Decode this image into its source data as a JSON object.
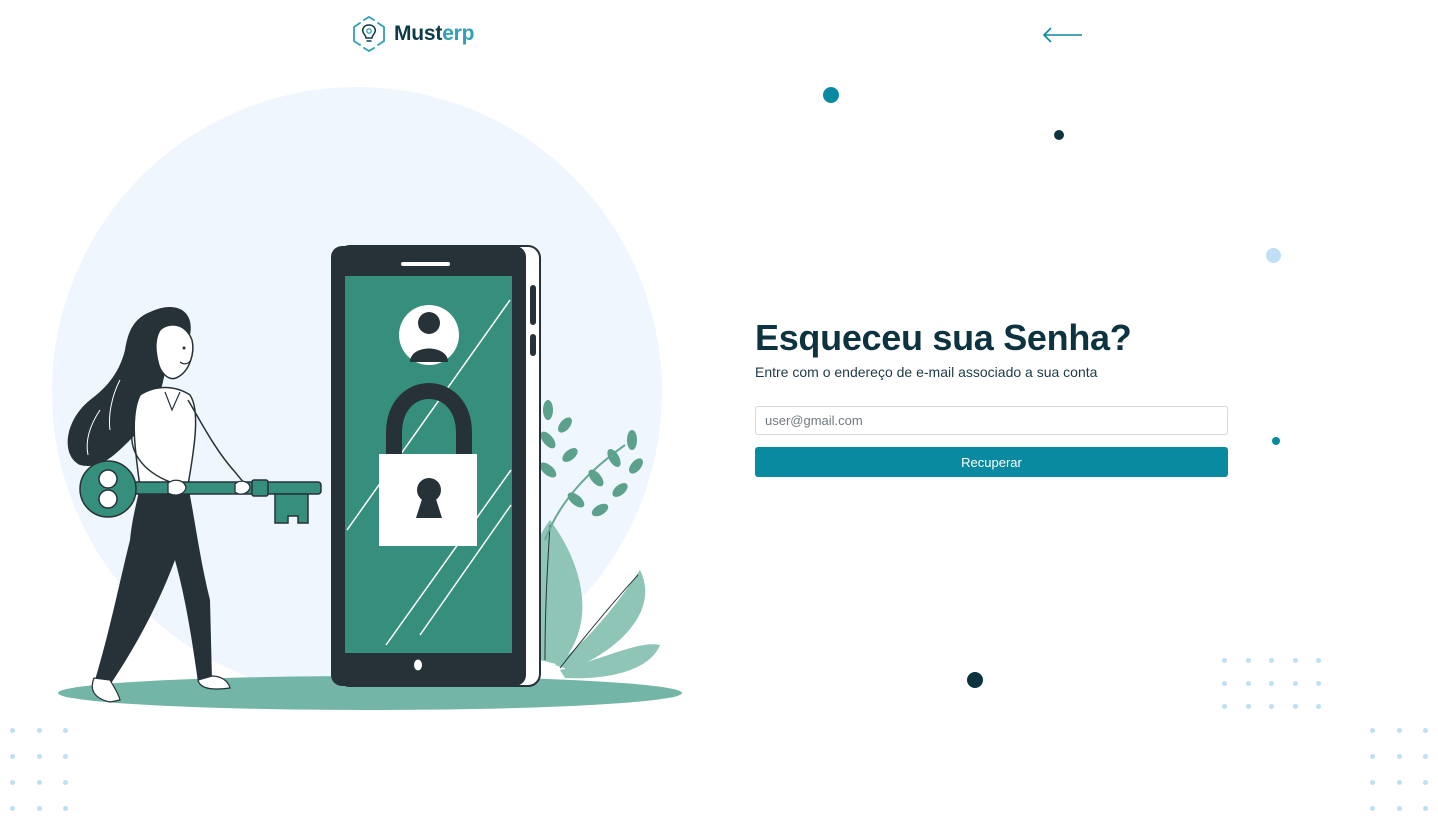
{
  "brand": {
    "name_part1": "Must",
    "name_part2": "erp"
  },
  "icons": {
    "logo": "lightbulb-gear-icon",
    "back": "arrow-left-icon"
  },
  "form": {
    "title": "Esqueceu sua Senha?",
    "subtitle": "Entre com o endereço de e-mail associado a sua conta",
    "email_placeholder": "user@gmail.com",
    "email_value": "",
    "submit_label": "Recuperar"
  },
  "colors": {
    "brand_dark": "#0d3b49",
    "brand_accent": "#2fa0b5",
    "button": "#0a8aa0",
    "illustration_green": "#368f7c",
    "phone_body": "#263238",
    "circle_bg": "#eff6fd"
  }
}
